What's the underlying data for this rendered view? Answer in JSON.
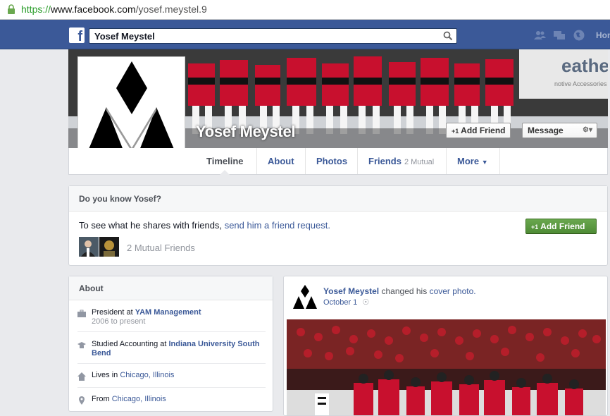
{
  "browser": {
    "url_scheme": "https://",
    "url_host": "www.facebook.com",
    "url_path": "/yosef.meystel.9"
  },
  "topbar": {
    "logo": "f",
    "search_value": "Yosef Meystel",
    "home_label": "Hom"
  },
  "cover": {
    "name": "Yosef Meystel",
    "add_friend_label": "Add Friend",
    "message_label": "Message",
    "bg_sign_text": "eathe",
    "bg_sign_sub": "notive Accessories"
  },
  "tabs": [
    {
      "label": "Timeline"
    },
    {
      "label": "About"
    },
    {
      "label": "Photos"
    },
    {
      "label": "Friends",
      "sub": "2 Mutual"
    },
    {
      "label": "More"
    }
  ],
  "know": {
    "title": "Do you know Yosef?",
    "text_prefix": "To see what he shares with friends,",
    "text_link": "send him a friend request.",
    "add_friend_label": "Add Friend",
    "mutual_count": "2 Mutual Friends"
  },
  "about": {
    "title": "About",
    "work_prefix": "President at",
    "work_company": "YAM Management",
    "work_years": "2006 to present",
    "edu_prefix": "Studied Accounting at",
    "edu_school": "Indiana University South Bend",
    "lives_prefix": "Lives in",
    "lives_place": "Chicago, Illinois",
    "from_prefix": "From",
    "from_place": "Chicago, Illinois"
  },
  "post": {
    "author": "Yosef Meystel",
    "action_text": "changed his",
    "action_link": "cover photo.",
    "date": "October 1"
  },
  "colors": {
    "brand_blue": "#3b5998",
    "green_button": "#4e8b35"
  }
}
